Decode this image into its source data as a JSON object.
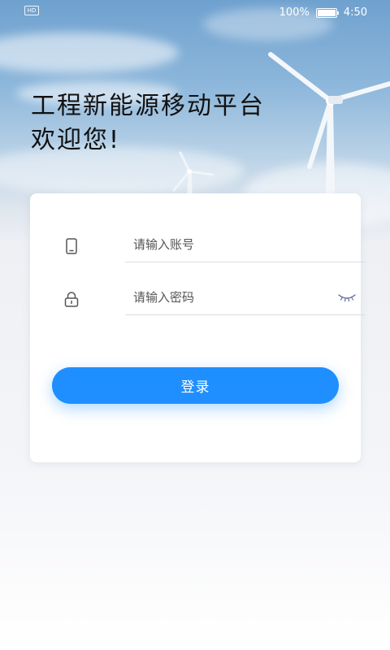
{
  "status_bar": {
    "hd_label": "HD",
    "battery_percent_text": "100%",
    "battery_level": 1.0,
    "time": "4:50"
  },
  "hero": {
    "title_line1": "工程新能源移动平台",
    "title_line2": "欢迎您!"
  },
  "login_form": {
    "account_placeholder": "请输入账号",
    "account_value": "",
    "account_icon": "phone-icon",
    "password_placeholder": "请输入密码",
    "password_value": "",
    "password_icon": "lock-icon",
    "visibility_icon": "eye-closed-icon",
    "submit_label": "登录"
  },
  "colors": {
    "accent": "#1f8fff",
    "title_text": "#111111"
  }
}
